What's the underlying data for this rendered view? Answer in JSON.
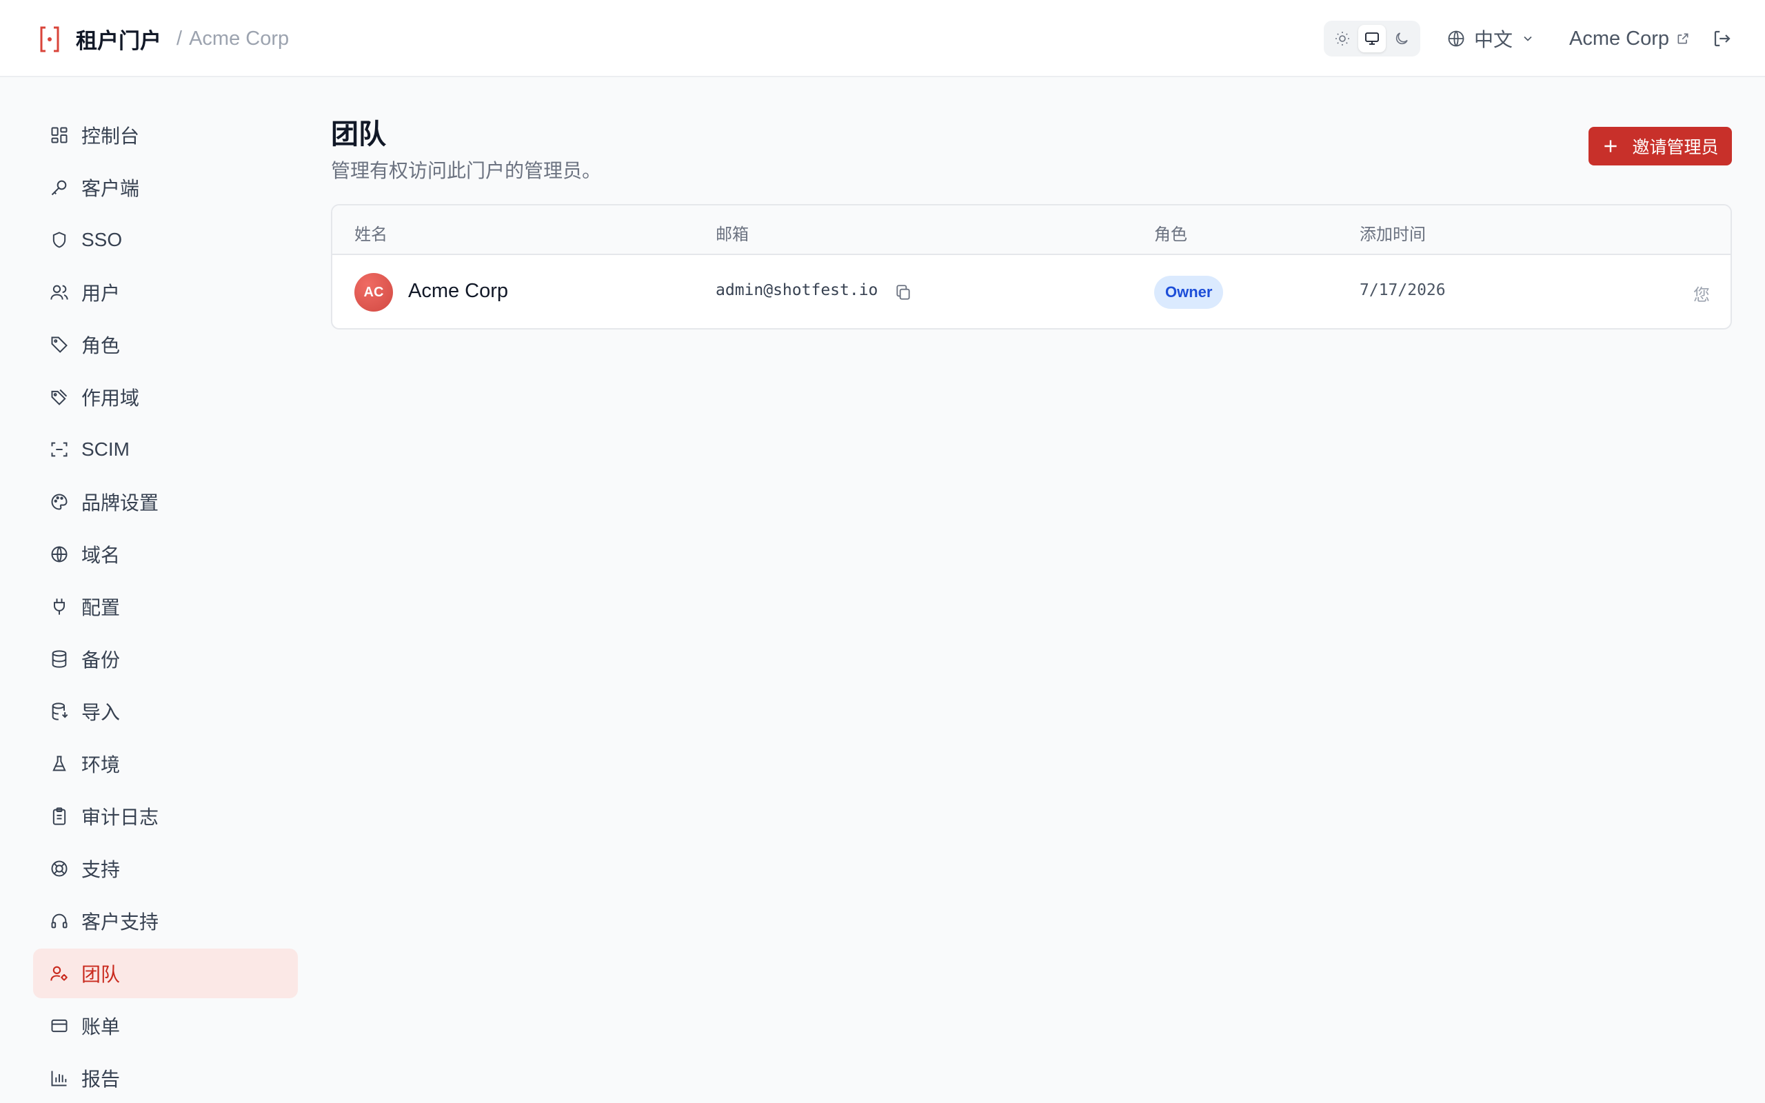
{
  "header": {
    "title": "租户门户",
    "breadcrumb_sep": "/",
    "breadcrumb": "Acme Corp",
    "language": "中文",
    "tenant_link": "Acme Corp"
  },
  "sidebar": {
    "items": [
      {
        "label": "控制台",
        "icon": "dashboard-icon"
      },
      {
        "label": "客户端",
        "icon": "key-icon"
      },
      {
        "label": "SSO",
        "icon": "shield-icon"
      },
      {
        "label": "用户",
        "icon": "users-icon"
      },
      {
        "label": "角色",
        "icon": "tag-icon"
      },
      {
        "label": "作用域",
        "icon": "tags-icon"
      },
      {
        "label": "SCIM",
        "icon": "scan-icon"
      },
      {
        "label": "品牌设置",
        "icon": "palette-icon"
      },
      {
        "label": "域名",
        "icon": "globe-icon"
      },
      {
        "label": "配置",
        "icon": "plug-icon"
      },
      {
        "label": "备份",
        "icon": "database-icon"
      },
      {
        "label": "导入",
        "icon": "database-import-icon"
      },
      {
        "label": "环境",
        "icon": "flask-icon"
      },
      {
        "label": "审计日志",
        "icon": "clipboard-icon"
      },
      {
        "label": "支持",
        "icon": "lifebuoy-icon"
      },
      {
        "label": "客户支持",
        "icon": "headset-icon"
      },
      {
        "label": "团队",
        "icon": "user-cog-icon",
        "active": true
      },
      {
        "label": "账单",
        "icon": "credit-card-icon"
      },
      {
        "label": "报告",
        "icon": "bar-chart-icon"
      }
    ]
  },
  "main": {
    "title": "团队",
    "subtitle": "管理有权访问此门户的管理员。",
    "invite_button": "邀请管理员",
    "table": {
      "headers": [
        "姓名",
        "邮箱",
        "角色",
        "添加时间"
      ],
      "rows": [
        {
          "initials": "AC",
          "name": "Acme Corp",
          "email": "admin@shotfest.io",
          "role": "Owner",
          "added": "7/17/2026",
          "note": "您"
        }
      ]
    }
  },
  "colors": {
    "accent": "#c8302a",
    "active_bg": "#fbe8e6",
    "badge_bg": "#dbeafe",
    "badge_text": "#1d4ed8"
  }
}
